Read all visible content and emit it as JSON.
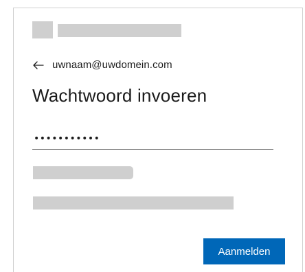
{
  "account": {
    "back_icon": "back-arrow-icon",
    "email": "uwnaam@uwdomein.com"
  },
  "title": "Wachtwoord invoeren",
  "password": {
    "value": "•••••••••••"
  },
  "actions": {
    "signin_label": "Aanmelden"
  },
  "colors": {
    "accent": "#0067b8",
    "placeholder_gray": "#cfcfcf",
    "text": "#1b1b1b",
    "border": "#d0d0d0"
  }
}
